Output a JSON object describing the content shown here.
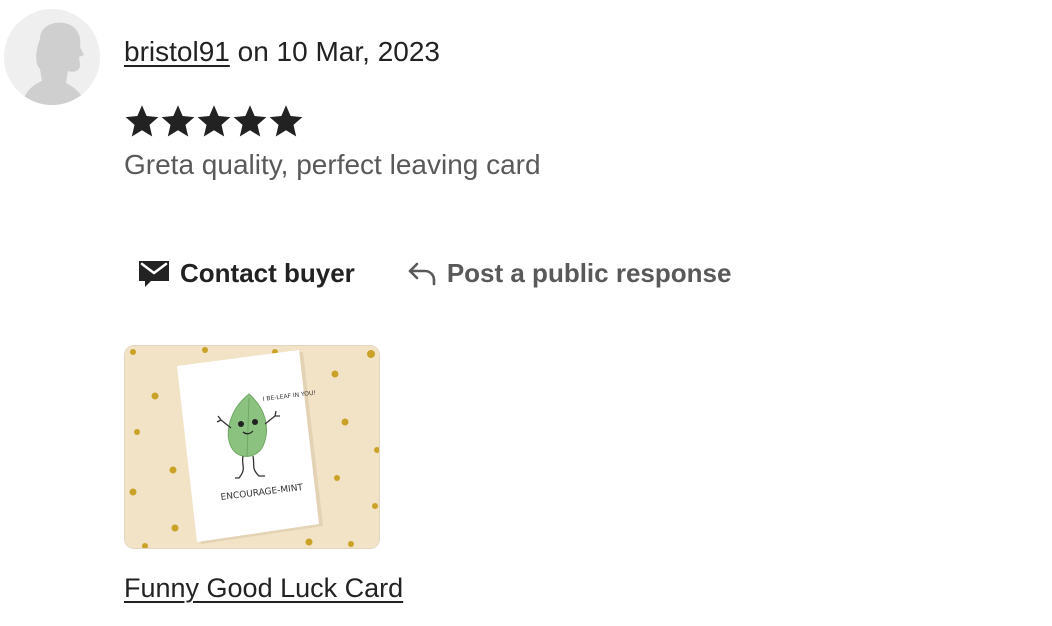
{
  "review": {
    "username": "bristol91",
    "date_text": " on 10 Mar, 2023",
    "rating": 5,
    "rating_max": 5,
    "text": "Greta quality, perfect leaving card"
  },
  "actions": {
    "contact_label": "Contact buyer",
    "response_label": "Post a public response"
  },
  "listing": {
    "title": "Funny Good Luck Card",
    "card_caption": "ENCOURAGE-MINT",
    "card_speech": "I BE-LEAF IN YOU!"
  },
  "colors": {
    "text_primary": "#222222",
    "text_secondary": "#595959",
    "star": "#222222",
    "thumb_background": "#f3e3c6",
    "confetti": "#c9a227",
    "leaf": "#8cc280"
  },
  "icons": {
    "avatar": "default-avatar-icon",
    "star": "star-icon",
    "contact": "envelope-icon",
    "response": "reply-arrow-icon"
  }
}
